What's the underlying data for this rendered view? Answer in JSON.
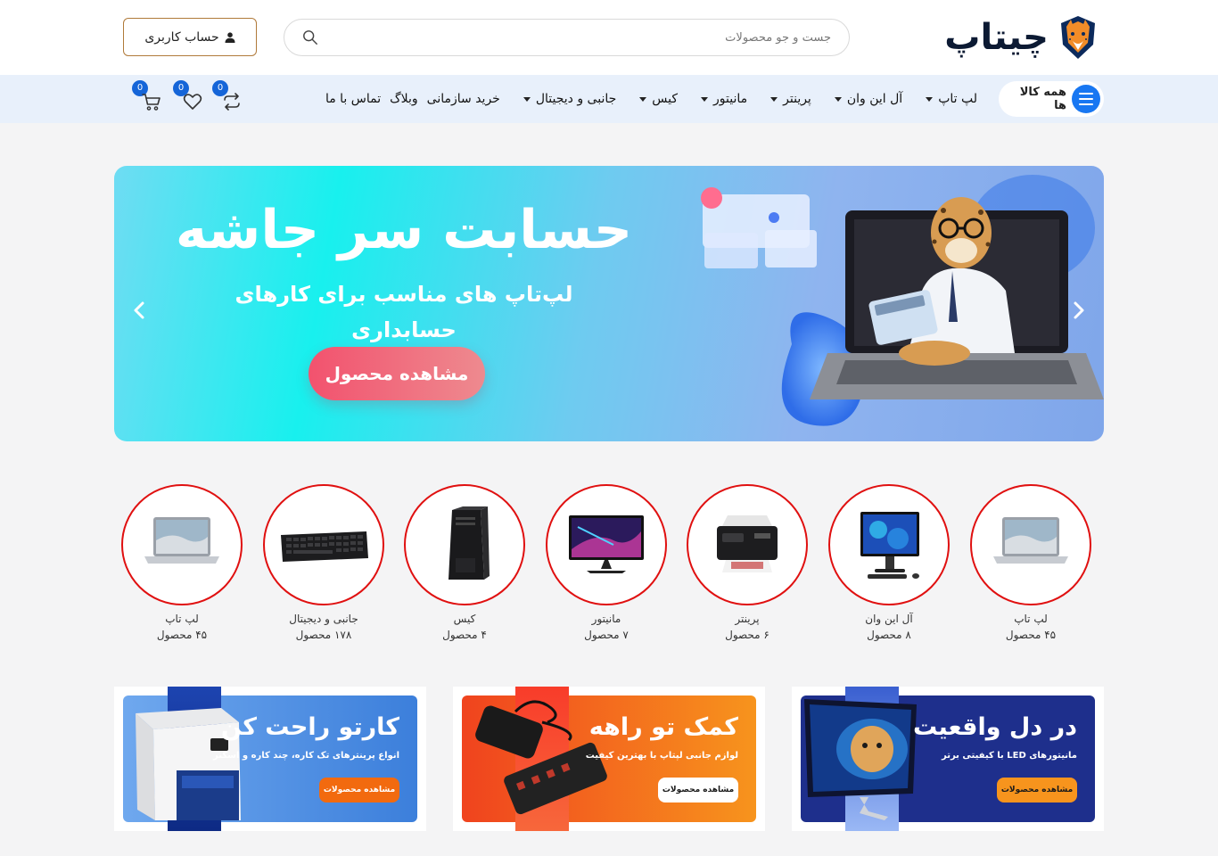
{
  "header": {
    "logo_text": "چیتاپ",
    "search_placeholder": "جست و جو محصولات",
    "account_label": "حساب کاربری"
  },
  "nav": {
    "all_categories": "همه کالا ها",
    "menu": [
      {
        "label": "لپ تاپ",
        "dropdown": true
      },
      {
        "label": "آل این وان",
        "dropdown": true
      },
      {
        "label": "پرینتر",
        "dropdown": true
      },
      {
        "label": "مانیتور",
        "dropdown": true
      },
      {
        "label": "کیس",
        "dropdown": true
      },
      {
        "label": "جانبی و دیجیتال",
        "dropdown": true
      },
      {
        "label": "خرید سازمانی",
        "dropdown": false
      },
      {
        "label": "وبلاگ",
        "dropdown": false
      },
      {
        "label": "تماس با ما",
        "dropdown": false
      }
    ],
    "compare_count": "0",
    "wishlist_count": "0",
    "cart_count": "0"
  },
  "hero": {
    "title": "حسابت سر جاشه",
    "subtitle": "لپ‌تاپ‌ های مناسب برای کارهای حسابداری",
    "button": "مشاهده محصول"
  },
  "categories": [
    {
      "name": "لپ تاپ",
      "count": "۴۵ محصول",
      "icon": "laptop"
    },
    {
      "name": "آل این وان",
      "count": "۸ محصول",
      "icon": "all-in-one"
    },
    {
      "name": "پرینتر",
      "count": "۶ محصول",
      "icon": "printer"
    },
    {
      "name": "مانیتور",
      "count": "۷ محصول",
      "icon": "monitor"
    },
    {
      "name": "کیس",
      "count": "۴ محصول",
      "icon": "case"
    },
    {
      "name": "جانبی و دیجیتال",
      "count": "۱۷۸ محصول",
      "icon": "keyboard"
    },
    {
      "name": "لپ تاپ",
      "count": "۴۵ محصول",
      "icon": "laptop"
    }
  ],
  "promos": [
    {
      "title": "در دل واقعیت",
      "subtitle": "مانیتورهای LED با کیفیتی برتر",
      "button": "مشاهده محصولات",
      "bg": "#1e2f8c",
      "button_bg": "#f7941d"
    },
    {
      "title": "کمک تو راهه",
      "subtitle": "لوازم جانبی لپتاپ با بهترین کیفیت",
      "button": "مشاهده محصولات",
      "bg": "#f58220",
      "button_bg": "#ffffff"
    },
    {
      "title": "کارتو راحت کن",
      "subtitle": "انواع پرینترهای تک کاره، چند کاره و اسکنر",
      "button": "مشاهده محصولات",
      "bg": "#5a9be6",
      "button_bg": "#f26a0f"
    }
  ],
  "colors": {
    "accent": "#1877f2",
    "category_border": "#e01010",
    "account_border": "#b07a3a",
    "nav_bg": "#e8f0fb"
  }
}
